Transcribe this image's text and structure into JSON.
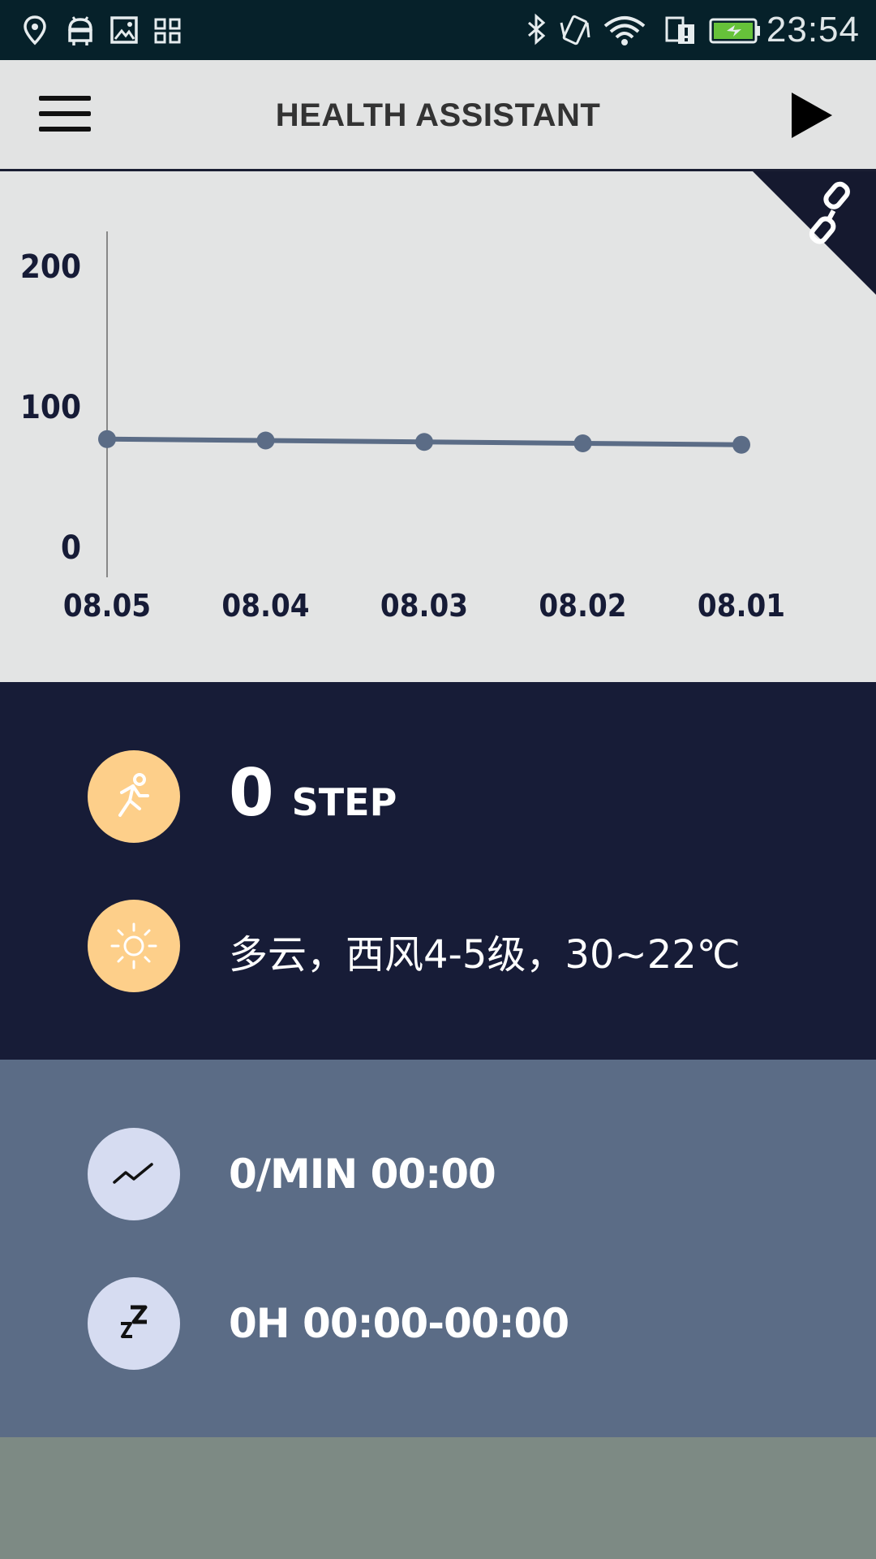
{
  "status_bar": {
    "time": "23:54",
    "left_icons": [
      "location-icon",
      "android-icon",
      "image-icon",
      "grid-icon"
    ],
    "right_icons": [
      "bluetooth-icon",
      "vibrate-icon",
      "wifi-icon",
      "sim-icon",
      "battery-icon"
    ]
  },
  "app_bar": {
    "title": "HEALTH ASSISTANT"
  },
  "chart_data": {
    "type": "line",
    "categories": [
      "08.05",
      "08.04",
      "08.03",
      "08.02",
      "08.01"
    ],
    "series": [
      {
        "values": [
          77,
          76,
          75,
          74,
          73
        ]
      }
    ],
    "yticks": [
      "200",
      "100",
      "0"
    ],
    "ylim": [
      0,
      200
    ],
    "title": "",
    "xlabel": "",
    "ylabel": "",
    "line_color": "#5b6c86"
  },
  "steps": {
    "value": "0",
    "unit": "STEP"
  },
  "weather": {
    "text": "多云，西风4-5级，30~22℃"
  },
  "heart_rate": {
    "text": "0/MIN 00:00"
  },
  "sleep": {
    "text": "0H  00:00-00:00"
  },
  "colors": {
    "dark_navy": "#171c37",
    "slate": "#5b6c86",
    "orange": "#fdcf8a",
    "lavender": "#d6dcf1",
    "chart_bg": "#e3e4e4"
  }
}
